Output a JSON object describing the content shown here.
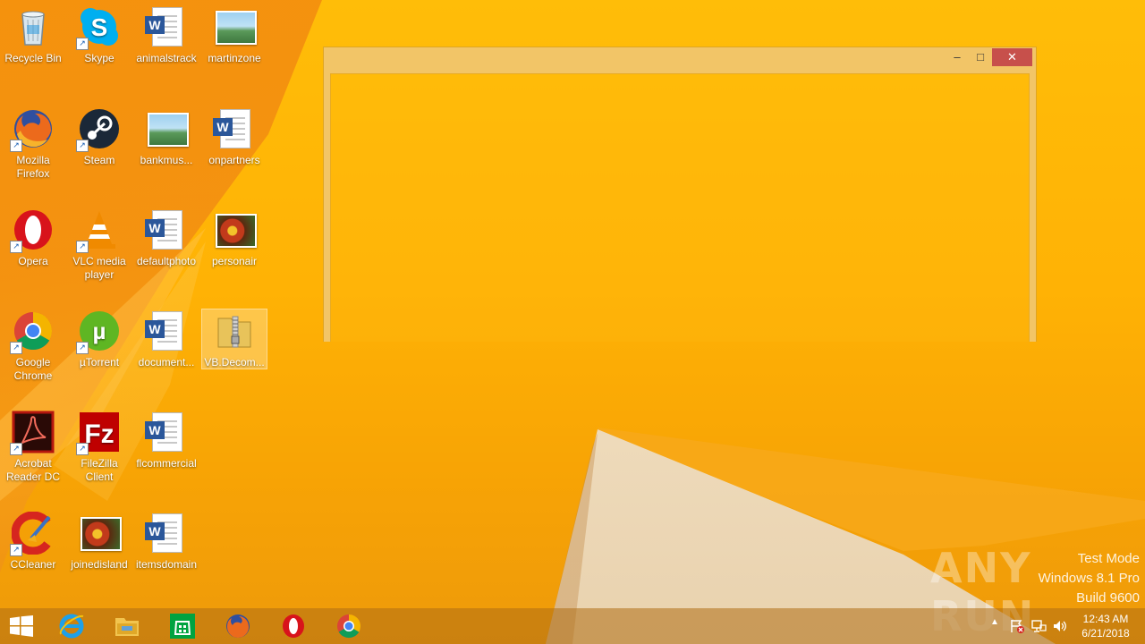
{
  "desktop": {
    "icons": [
      {
        "label": "Recycle Bin"
      },
      {
        "label": "Skype"
      },
      {
        "label": "animalstrack"
      },
      {
        "label": "martinzone"
      },
      {
        "label": "Mozilla Firefox"
      },
      {
        "label": "Steam"
      },
      {
        "label": "bankmus..."
      },
      {
        "label": "onpartners"
      },
      {
        "label": "Opera"
      },
      {
        "label": "VLC media player"
      },
      {
        "label": "defaultphoto"
      },
      {
        "label": "personair"
      },
      {
        "label": "Google Chrome"
      },
      {
        "label": "µTorrent"
      },
      {
        "label": "document..."
      },
      {
        "label": "VB.Decom..."
      },
      {
        "label": "Acrobat Reader DC"
      },
      {
        "label": "FileZilla Client"
      },
      {
        "label": "flcommercial"
      },
      {
        "label": "CCleaner"
      },
      {
        "label": "joinedisland"
      },
      {
        "label": "itemsdomain"
      }
    ]
  },
  "window": {
    "minimize": "–",
    "maximize": "□",
    "close": "✕"
  },
  "watermark": {
    "line1": "Test Mode",
    "line2": "Windows 8.1 Pro",
    "line3": "Build 9600",
    "brand": "ANY RUN"
  },
  "taskbar": {
    "items": [
      "start",
      "internet-explorer",
      "file-explorer",
      "store",
      "firefox",
      "opera",
      "chrome"
    ],
    "tray_chevron": "▲",
    "time": "12:43 AM",
    "date": "6/21/2018"
  },
  "colors": {
    "wallpaper": "#ffb205",
    "close_button": "#c7504b",
    "window_frame": "#f2c567"
  }
}
